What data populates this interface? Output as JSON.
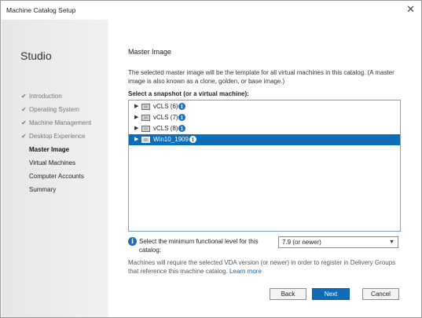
{
  "window": {
    "title": "Machine Catalog Setup",
    "close_glyph": "✕"
  },
  "sidebar": {
    "app_name": "Studio",
    "steps": [
      {
        "label": "Introduction",
        "state": "done"
      },
      {
        "label": "Operating System",
        "state": "done"
      },
      {
        "label": "Machine Management",
        "state": "done"
      },
      {
        "label": "Desktop Experience",
        "state": "done"
      },
      {
        "label": "Master Image",
        "state": "current"
      },
      {
        "label": "Virtual Machines",
        "state": "pending"
      },
      {
        "label": "Computer Accounts",
        "state": "pending"
      },
      {
        "label": "Summary",
        "state": "pending"
      }
    ],
    "check_glyph": "✔"
  },
  "main": {
    "heading": "Master Image",
    "description": "The selected master image will be the template for all virtual machines in this catalog. (A master image is also known as a clone, golden, or base image.)",
    "snapshot_label": "Select a snapshot (or a virtual machine):",
    "tree": [
      {
        "name": "vCLS (6)",
        "selected": false
      },
      {
        "name": "vCLS (7)",
        "selected": false
      },
      {
        "name": "vCLS (8)",
        "selected": false
      },
      {
        "name": "Win10_1909",
        "selected": true
      }
    ],
    "functional_level": {
      "label": "Select the minimum functional level for this catalog:",
      "value": "7.9 (or newer)"
    },
    "note": "Machines will require the selected VDA version (or newer) in order to register in Delivery Groups that reference this machine catalog.",
    "learn_more": "Learn more"
  },
  "buttons": {
    "back": "Back",
    "next": "Next",
    "cancel": "Cancel"
  },
  "colors": {
    "accent": "#0e6db9",
    "info_icon": "#1f6bb5"
  }
}
